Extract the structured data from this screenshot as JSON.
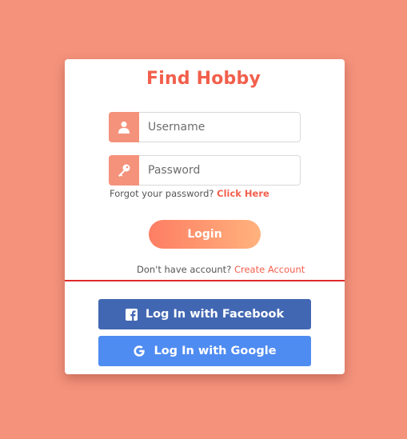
{
  "app": {
    "title": "Find Hobby"
  },
  "login_form": {
    "username_placeholder": "Username",
    "username_value": "",
    "password_placeholder": "Password",
    "password_value": "",
    "forgot_text": "Forgot your password?",
    "forgot_link": "Click Here",
    "login_label": "Login",
    "signup_text": "Don't have account?",
    "signup_link": "Create Account"
  },
  "social": {
    "facebook_label": "Log In with Facebook",
    "google_label": "Log In with Google"
  },
  "colors": {
    "background": "#f4927c",
    "accent": "#f25f4c",
    "divider": "#e02a2a",
    "facebook": "#4267b2",
    "google": "#4f8cf1"
  },
  "icons": [
    "user-icon",
    "key-icon",
    "facebook-icon",
    "google-icon"
  ]
}
